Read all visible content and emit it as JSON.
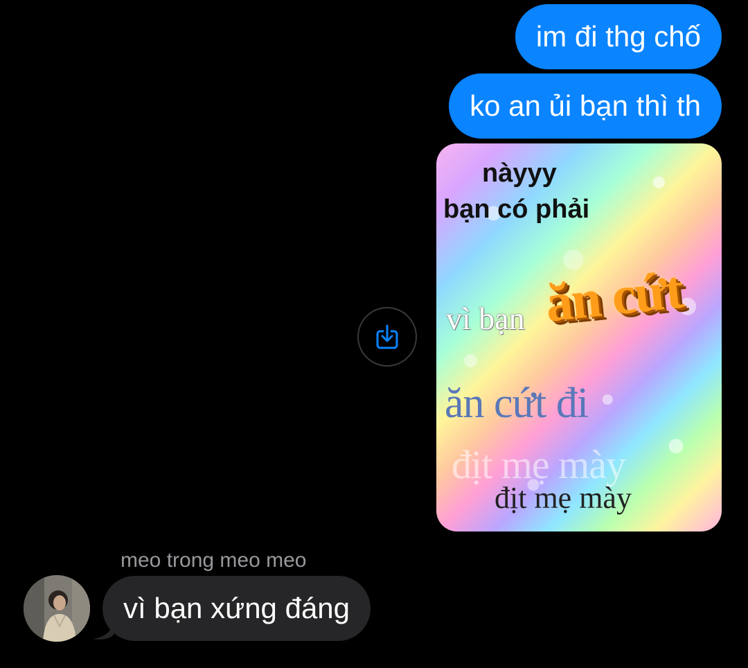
{
  "colors": {
    "background": "#000000",
    "outgoing_bubble": "#0a84ff",
    "incoming_bubble": "#262628",
    "sender_name": "#98989d",
    "share_icon": "#0a84ff"
  },
  "conversation": {
    "outgoing": [
      {
        "text": "im đi thg chố"
      },
      {
        "text": "ko an ủi bạn thì th"
      }
    ],
    "image_message": {
      "lines": [
        "nàyyy",
        "bạn có phải",
        "vì bạn",
        "ăn cứt",
        "ăn cứt đi",
        "địt mẹ mày",
        "địt mẹ mày"
      ],
      "share_icon": "share-download-icon"
    },
    "incoming": {
      "sender": "meo trong meo meo",
      "text": "vì bạn xứng đáng",
      "avatar_icon": "avatar-photo"
    }
  }
}
